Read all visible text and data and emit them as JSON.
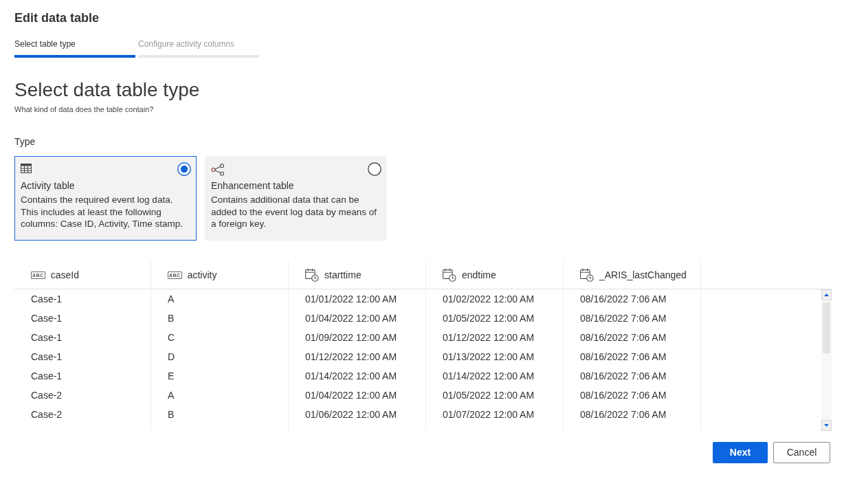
{
  "dialog": {
    "title": "Edit data table"
  },
  "steps": [
    {
      "label": "Select table type",
      "selected": true
    },
    {
      "label": "Configure activity columns",
      "selected": false
    }
  ],
  "page": {
    "heading": "Select data table type",
    "subtitle": "What kind of data does the table contain?"
  },
  "type_field": {
    "label": "Type",
    "options": [
      {
        "kind": "table",
        "title": "Activity table",
        "description": "Contains the required event log data. This includes at least the following columns: Case ID, Activity, Time stamp.",
        "selected": true
      },
      {
        "kind": "network",
        "title": "Enhancement table",
        "description": "Contains additional data that can be added to the event log data by means of a foreign key.",
        "selected": false
      }
    ]
  },
  "table": {
    "columns": [
      {
        "label": "caseId",
        "kind": "text",
        "badge": "ABC"
      },
      {
        "label": "activity",
        "kind": "text",
        "badge": "ABC"
      },
      {
        "label": "starttime",
        "kind": "datetime"
      },
      {
        "label": "endtime",
        "kind": "datetime"
      },
      {
        "label": "_ARIS_lastChanged",
        "kind": "datetime"
      }
    ],
    "rows": [
      [
        "Case-1",
        "A",
        "01/01/2022 12:00 AM",
        "01/02/2022 12:00 AM",
        "08/16/2022 7:06 AM"
      ],
      [
        "Case-1",
        "B",
        "01/04/2022 12:00 AM",
        "01/05/2022 12:00 AM",
        "08/16/2022 7:06 AM"
      ],
      [
        "Case-1",
        "C",
        "01/09/2022 12:00 AM",
        "01/12/2022 12:00 AM",
        "08/16/2022 7:06 AM"
      ],
      [
        "Case-1",
        "D",
        "01/12/2022 12:00 AM",
        "01/13/2022 12:00 AM",
        "08/16/2022 7:06 AM"
      ],
      [
        "Case-1",
        "E",
        "01/14/2022 12:00 AM",
        "01/14/2022 12:00 AM",
        "08/16/2022 7:06 AM"
      ],
      [
        "Case-2",
        "A",
        "01/04/2022 12:00 AM",
        "01/05/2022 12:00 AM",
        "08/16/2022 7:06 AM"
      ],
      [
        "Case-2",
        "B",
        "01/06/2022 12:00 AM",
        "01/07/2022 12:00 AM",
        "08/16/2022 7:06 AM"
      ]
    ]
  },
  "buttons": [
    {
      "label": "Next",
      "kind": "primary"
    },
    {
      "label": "Cancel",
      "kind": "secondary"
    }
  ]
}
